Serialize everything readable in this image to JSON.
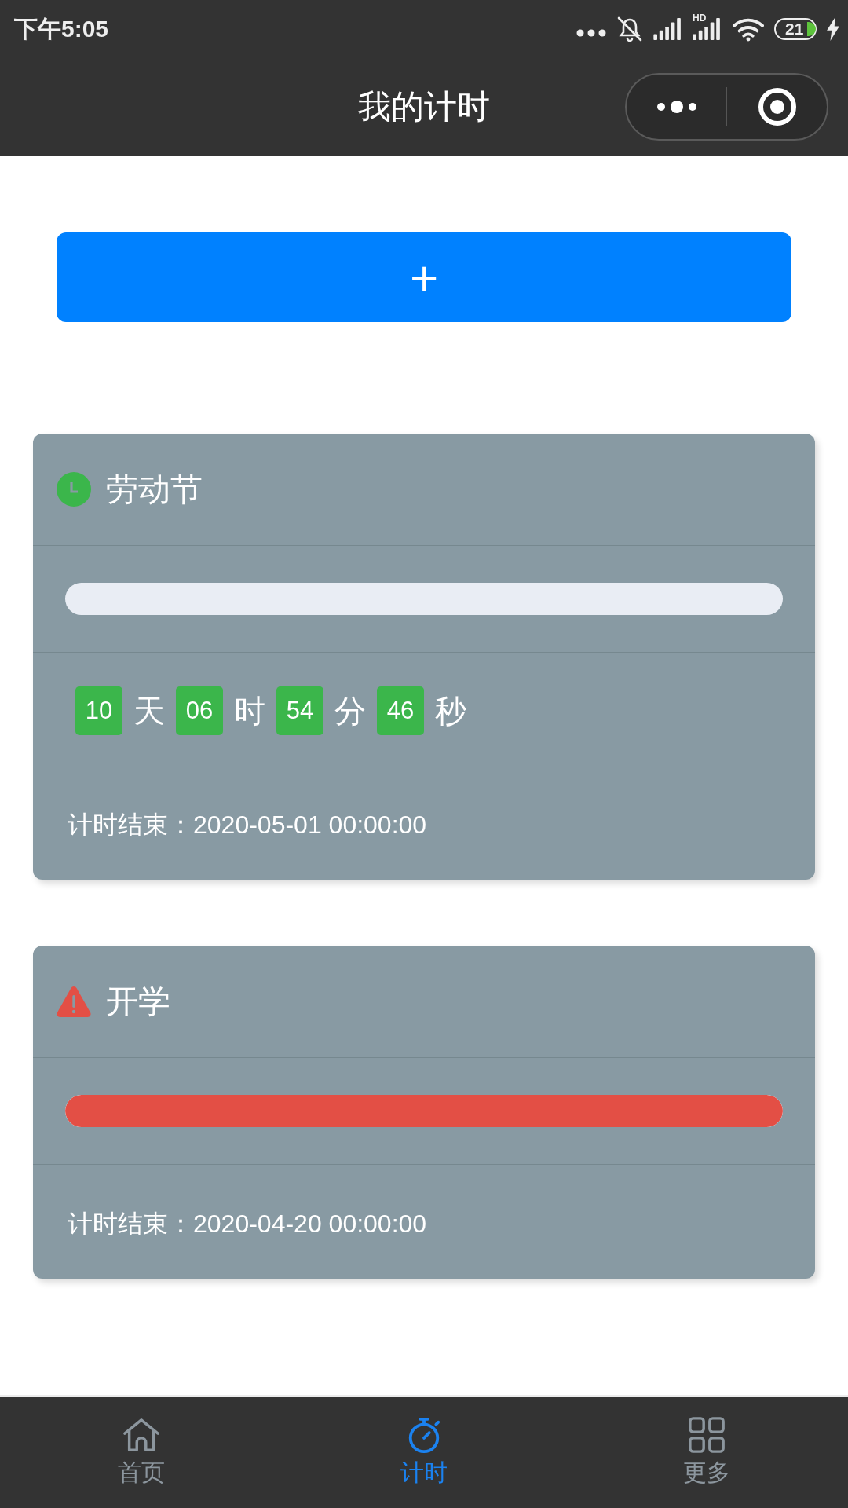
{
  "status_bar": {
    "time": "下午5:05",
    "network_label": "HD",
    "battery": "21"
  },
  "nav_bar": {
    "title": "我的计时"
  },
  "add_button": {
    "label": "+"
  },
  "timers": [
    {
      "kind": "running",
      "title": "劳动节",
      "level": 0,
      "countdown": [
        {
          "value": "10",
          "unit": "天"
        },
        {
          "value": "06",
          "unit": "时"
        },
        {
          "value": "54",
          "unit": "分"
        },
        {
          "value": "46",
          "unit": "秒"
        }
      ],
      "end_text": "计时结束：2020-05-01 00:00:00"
    },
    {
      "kind": "expired",
      "title": "开学",
      "level": 1,
      "end_text": "计时结束：2020-04-20 00:00:00"
    }
  ],
  "tab_bar": [
    {
      "label": "首页",
      "selected": false
    },
    {
      "label": "计时",
      "selected": true
    },
    {
      "label": "更多",
      "selected": false
    }
  ]
}
